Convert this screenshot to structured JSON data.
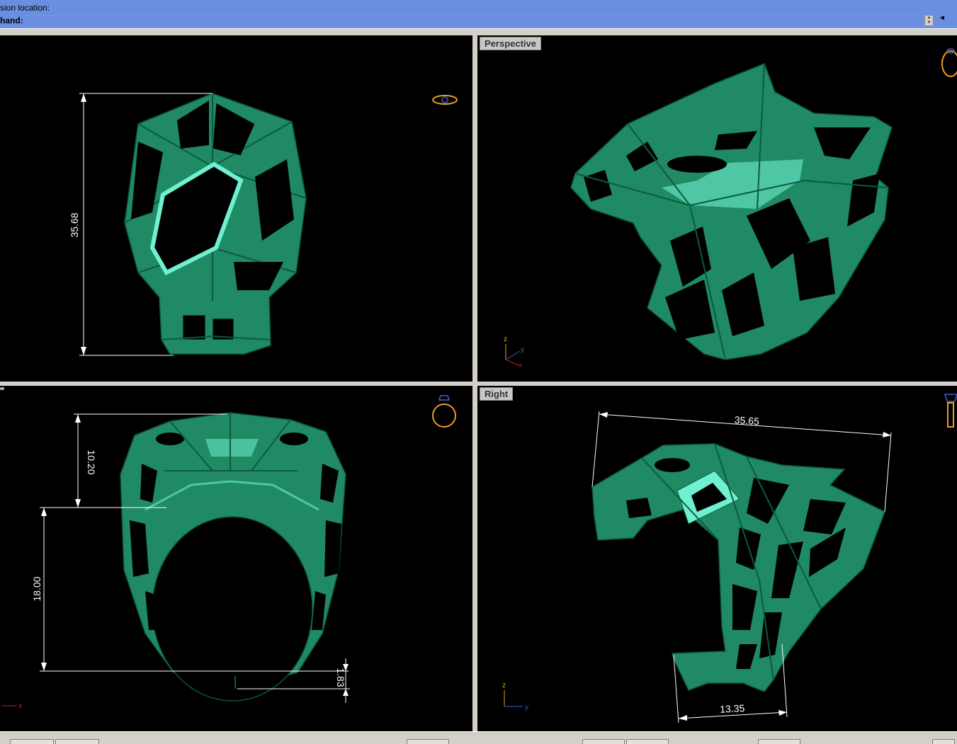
{
  "command": {
    "history_line": "sion location:",
    "prompt_label": "hand:",
    "input_value": ""
  },
  "viewports": {
    "top": {
      "title": ""
    },
    "perspective": {
      "title": "Perspective"
    },
    "front": {
      "title": ""
    },
    "right": {
      "title": "Right"
    }
  },
  "dimensions": {
    "top_height": "35.68",
    "front_upper": "10.20",
    "front_inner": "18.00",
    "front_band": "1.83",
    "right_length": "35.65",
    "right_base": "13.35"
  },
  "axes": {
    "x": "x",
    "y": "y",
    "z": "z"
  },
  "colors": {
    "model": "#1f8a63",
    "model_highlight": "#6ff0d0",
    "model_edge": "#0c5a3f",
    "viewport_bg": "#000000",
    "command_bar": "#6b8fe0",
    "icon_gold": "#e8a020"
  }
}
